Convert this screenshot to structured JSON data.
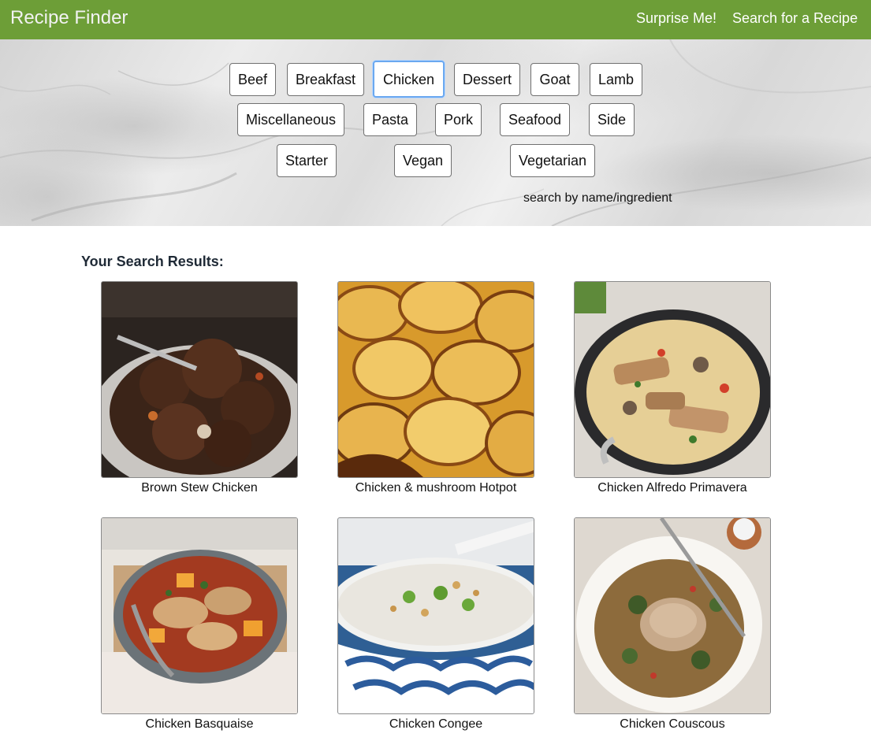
{
  "navbar": {
    "brand": "Recipe Finder",
    "links": [
      "Surprise Me!",
      "Search for a Recipe"
    ],
    "color": "#6d9e37"
  },
  "categories": {
    "items": [
      "Beef",
      "Breakfast",
      "Chicken",
      "Dessert",
      "Goat",
      "Lamb",
      "Miscellaneous",
      "Pasta",
      "Pork",
      "Seafood",
      "Side",
      "Starter",
      "Vegan",
      "Vegetarian"
    ],
    "selected": "Chicken"
  },
  "search": {
    "label": "search by name/ingredient"
  },
  "results": {
    "heading": "Your Search Results:",
    "items": [
      {
        "title": "Brown Stew Chicken",
        "image": "brown-stew-chicken-photo"
      },
      {
        "title": "Chicken & mushroom Hotpot",
        "image": "chicken-mushroom-hotpot-photo"
      },
      {
        "title": "Chicken Alfredo Primavera",
        "image": "chicken-alfredo-primavera-photo"
      },
      {
        "title": "Chicken Basquaise",
        "image": "chicken-basquaise-photo"
      },
      {
        "title": "Chicken Congee",
        "image": "chicken-congee-photo"
      },
      {
        "title": "Chicken Couscous",
        "image": "chicken-couscous-photo"
      }
    ]
  }
}
